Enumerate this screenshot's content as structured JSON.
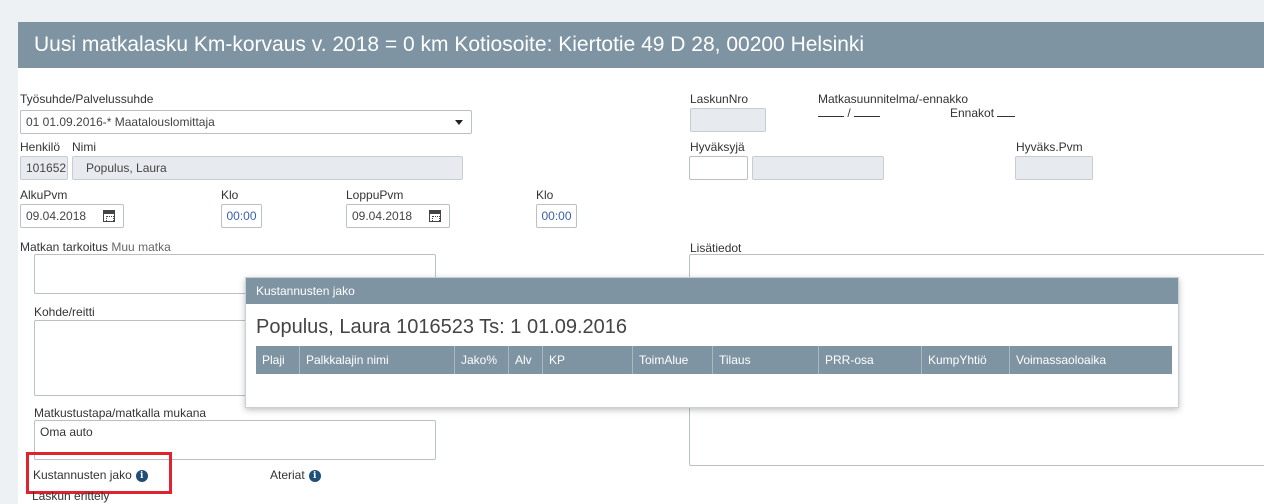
{
  "header": {
    "title": "Uusi matkalasku  Km-korvaus v. 2018 = 0 km  Kotiosoite: Kiertotie 49 D 28, 00200 Helsinki"
  },
  "form": {
    "employment_label": "Työsuhde/Palvelussuhde",
    "employment_value": "01 01.09.2016-* Maatalouslomittaja",
    "person_label": "Henkilö",
    "person_value": "101652",
    "name_label": "Nimi",
    "name_value": "Populus, Laura",
    "start_date_label": "AlkuPvm",
    "start_date_value": "09.04.2018",
    "start_time_label": "Klo",
    "start_time_value": "00:00",
    "end_date_label": "LoppuPvm",
    "end_date_value": "09.04.2018",
    "end_time_label": "Klo",
    "end_time_value": "00:00",
    "purpose_label": "Matkan tarkoitus",
    "purpose_hint": "Muu matka",
    "destination_label": "Kohde/reitti",
    "travel_mode_label": "Matkustustapa/matkalla mukana",
    "travel_mode_value": "Oma auto",
    "cost_split_label": "Kustannusten jako",
    "meals_label": "Ateriat",
    "invoice_detail_label": "Laskun erittely",
    "invoice_no_label": "LaskunNro",
    "travel_plan_label": "Matkasuunnitelma/-ennakko",
    "travel_plan_sep": "/",
    "advances_label": "Ennakot",
    "approver_label": "Hyväksyjä",
    "approval_date_label": "Hyväks.Pvm",
    "additional_info_label": "Lisätiedot"
  },
  "popup": {
    "header": "Kustannusten jako",
    "title": "Populus, Laura  1016523  Ts:   1  01.09.2016",
    "columns": [
      "Plaji",
      "Palkkalajin nimi",
      "Jako%",
      "Alv",
      "KP",
      "ToimAlue",
      "Tilaus",
      "PRR-osa",
      "KumpYhtiö",
      "Voimassaoloaika"
    ]
  },
  "colors": {
    "header_bg": "#7f94a3",
    "highlight": "#e0212e",
    "info_icon": "#1f4e79"
  }
}
